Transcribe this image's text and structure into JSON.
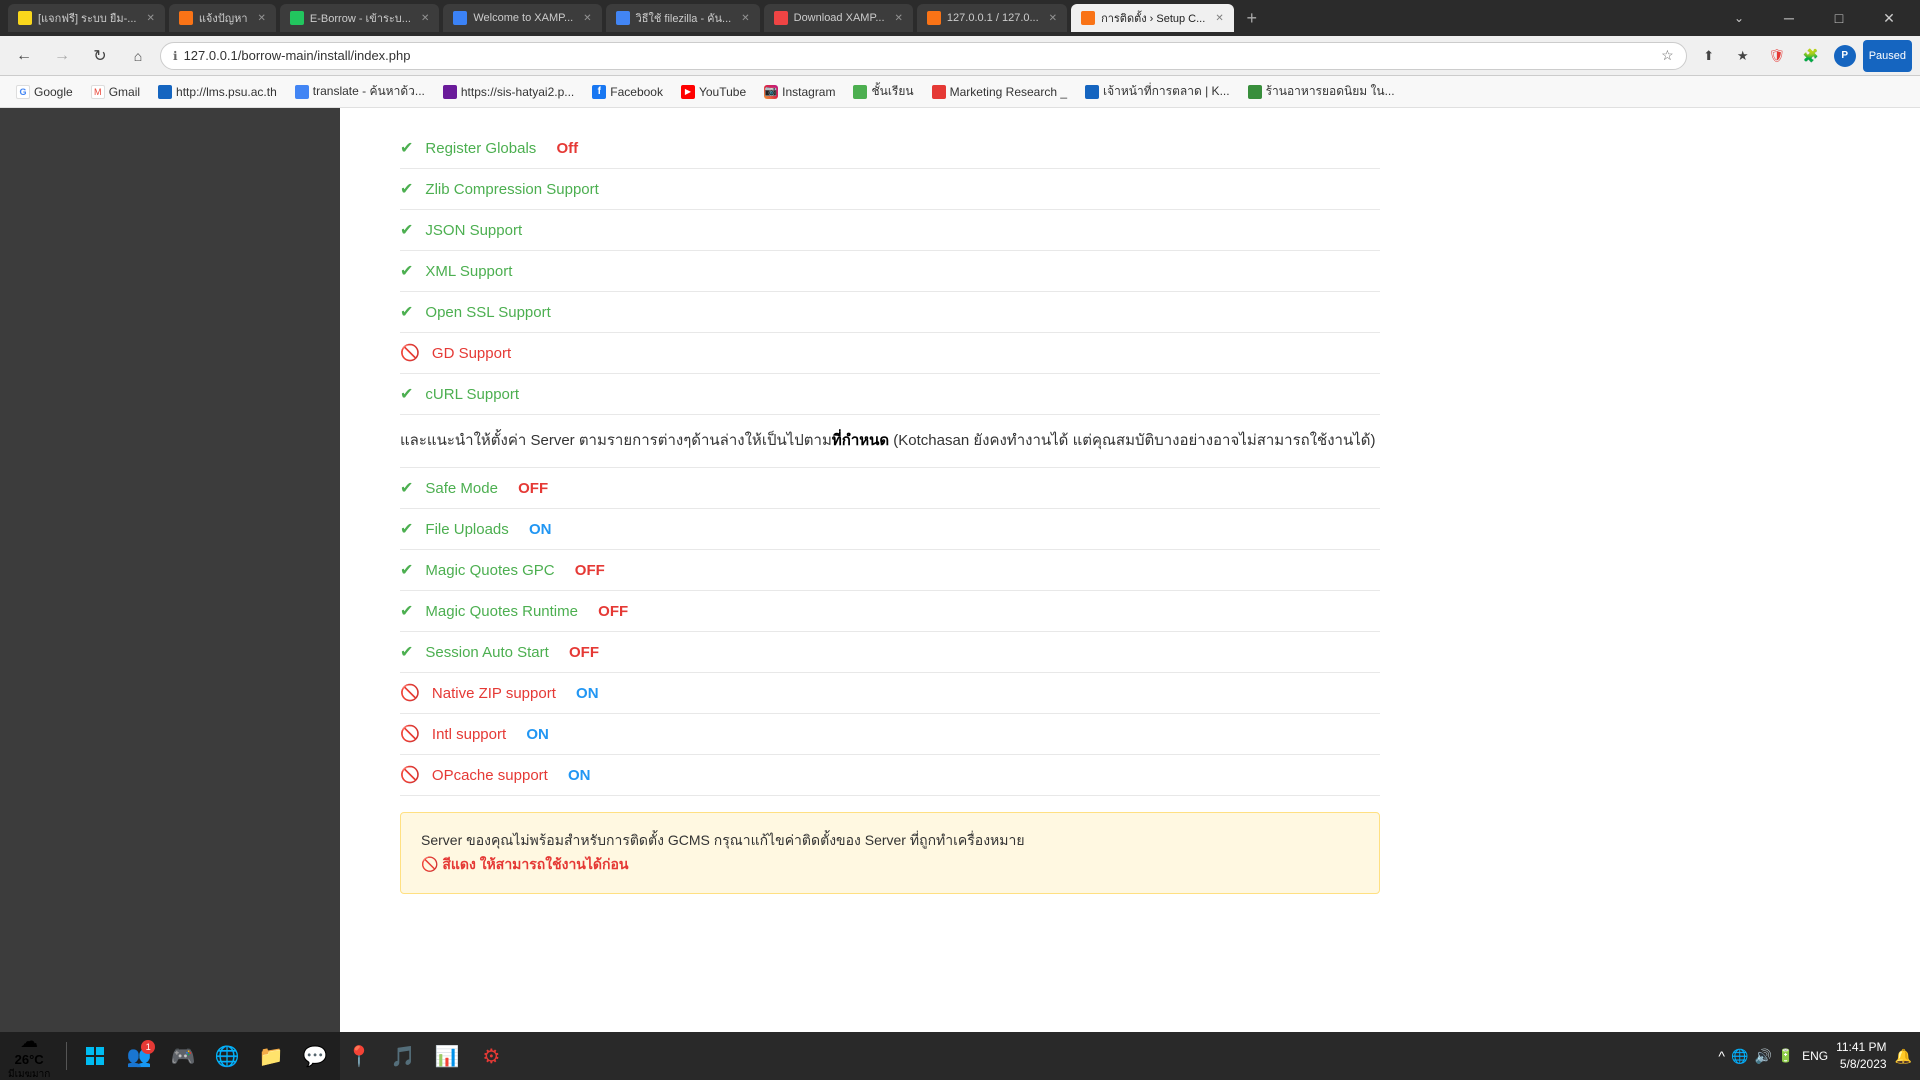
{
  "titlebar": {
    "tabs": [
      {
        "id": "tab1",
        "favicon_type": "fav-yellow",
        "label": "[แจกฟรี] ระบบ ยืม-...",
        "active": false
      },
      {
        "id": "tab2",
        "favicon_type": "fav-orange-tab",
        "label": "แจ้งปัญหา",
        "active": false
      },
      {
        "id": "tab3",
        "favicon_type": "fav-green2-tab",
        "label": "E-Borrow - เข้าระบ...",
        "active": false
      },
      {
        "id": "tab4",
        "favicon_type": "fav-blue2-tab",
        "label": "Welcome to XAMP...",
        "active": false
      },
      {
        "id": "tab5",
        "favicon_type": "fav-g",
        "label": "วิธีใช้ filezilla - คัน...",
        "active": false
      },
      {
        "id": "tab6",
        "favicon_type": "fav-red2-tab",
        "label": "Download XAMP...",
        "active": false
      },
      {
        "id": "tab7",
        "favicon_type": "fav-orange2-tab",
        "label": "127.0.0.1 / 127.0...",
        "active": false
      },
      {
        "id": "tab8",
        "favicon_type": "fav-settings",
        "label": "การติดตั้ง › Setup C...",
        "active": true
      }
    ],
    "controls": {
      "minimize": "─",
      "maximize": "□",
      "close": "✕"
    }
  },
  "navbar": {
    "back_disabled": false,
    "forward_disabled": true,
    "url": "127.0.0.1/borrow-main/install/index.php",
    "paused_label": "Paused"
  },
  "bookmarks": [
    {
      "id": "bm1",
      "favicon": "google",
      "label": "Google"
    },
    {
      "id": "bm2",
      "favicon": "gmail",
      "label": "Gmail"
    },
    {
      "id": "bm3",
      "favicon": "lms",
      "label": "http://lms.psu.ac.th"
    },
    {
      "id": "bm4",
      "favicon": "translate",
      "label": "translate - ค้นหาด้ว..."
    },
    {
      "id": "bm5",
      "favicon": "sis",
      "label": "https://sis-hatyai2.p..."
    },
    {
      "id": "bm6",
      "favicon": "fb",
      "label": "Facebook"
    },
    {
      "id": "bm7",
      "favicon": "yt",
      "label": "YouTube"
    },
    {
      "id": "bm8",
      "favicon": "ig",
      "label": "Instagram"
    },
    {
      "id": "bm9",
      "favicon": "school",
      "label": "ชั้นเรียน"
    },
    {
      "id": "bm10",
      "favicon": "marketing",
      "label": "Marketing Research _"
    },
    {
      "id": "bm11",
      "favicon": "market2",
      "label": "เจ้าหน้าที่การตลาด | K..."
    },
    {
      "id": "bm12",
      "favicon": "food",
      "label": "ร้านอาหารยอดนิยม ใน..."
    }
  ],
  "content": {
    "check_items": [
      {
        "id": "c1",
        "icon_type": "green",
        "label": "Register Globals",
        "value": "Off",
        "value_type": "off"
      },
      {
        "id": "c2",
        "icon_type": "green",
        "label": "Zlib Compression Support",
        "value": "",
        "value_type": "none"
      },
      {
        "id": "c3",
        "icon_type": "green",
        "label": "JSON Support",
        "value": "",
        "value_type": "none"
      },
      {
        "id": "c4",
        "icon_type": "green",
        "label": "XML Support",
        "value": "",
        "value_type": "none"
      },
      {
        "id": "c5",
        "icon_type": "green",
        "label": "Open SSL Support",
        "value": "",
        "value_type": "none"
      },
      {
        "id": "c6",
        "icon_type": "red",
        "label": "GD Support",
        "value": "",
        "value_type": "none"
      },
      {
        "id": "c7",
        "icon_type": "green",
        "label": "cURL Support",
        "value": "",
        "value_type": "none"
      }
    ],
    "description": "และแนะนำให้ตั้งค่า Server ตามรายการต่างๆด้านล่างให้เป็นไปตามที่กำหนด (Kotchasan ยังคงทำงานได้ แต่คุณสมบัติบางอย่างอาจไม่สามารถใช้งานได้)",
    "description_bold": "ที่กำหนด",
    "setting_items": [
      {
        "id": "s1",
        "icon_type": "green",
        "label": "Safe Mode",
        "value": "OFF",
        "value_type": "off"
      },
      {
        "id": "s2",
        "icon_type": "green",
        "label": "File Uploads",
        "value": "ON",
        "value_type": "on"
      },
      {
        "id": "s3",
        "icon_type": "green",
        "label": "Magic Quotes GPC",
        "value": "OFF",
        "value_type": "off"
      },
      {
        "id": "s4",
        "icon_type": "green",
        "label": "Magic Quotes Runtime",
        "value": "OFF",
        "value_type": "off"
      },
      {
        "id": "s5",
        "icon_type": "green",
        "label": "Session Auto Start",
        "value": "OFF",
        "value_type": "off"
      },
      {
        "id": "s6",
        "icon_type": "red",
        "label": "Native ZIP support",
        "value": "ON",
        "value_type": "on"
      },
      {
        "id": "s7",
        "icon_type": "red",
        "label": "Intl support",
        "value": "ON",
        "value_type": "on"
      },
      {
        "id": "s8",
        "icon_type": "red",
        "label": "OPcache support",
        "value": "ON",
        "value_type": "on"
      }
    ],
    "warning_text_1": "Server ของคุณไม่พร้อมสำหรับการติดตั้ง GCMS กรุณาแก้ไขค่าติดตั้งของ Server ที่ถูกทำเครื่องหมาย",
    "warning_text_2": "สีแดง ให้สามารถใช้งานได้ก่อน",
    "warning_icon": "🚫"
  },
  "taskbar": {
    "weather_temp": "26°C",
    "weather_desc": "มีเมฆมาก",
    "time": "11:41 PM",
    "date": "5/8/2023",
    "language": "ENG"
  }
}
